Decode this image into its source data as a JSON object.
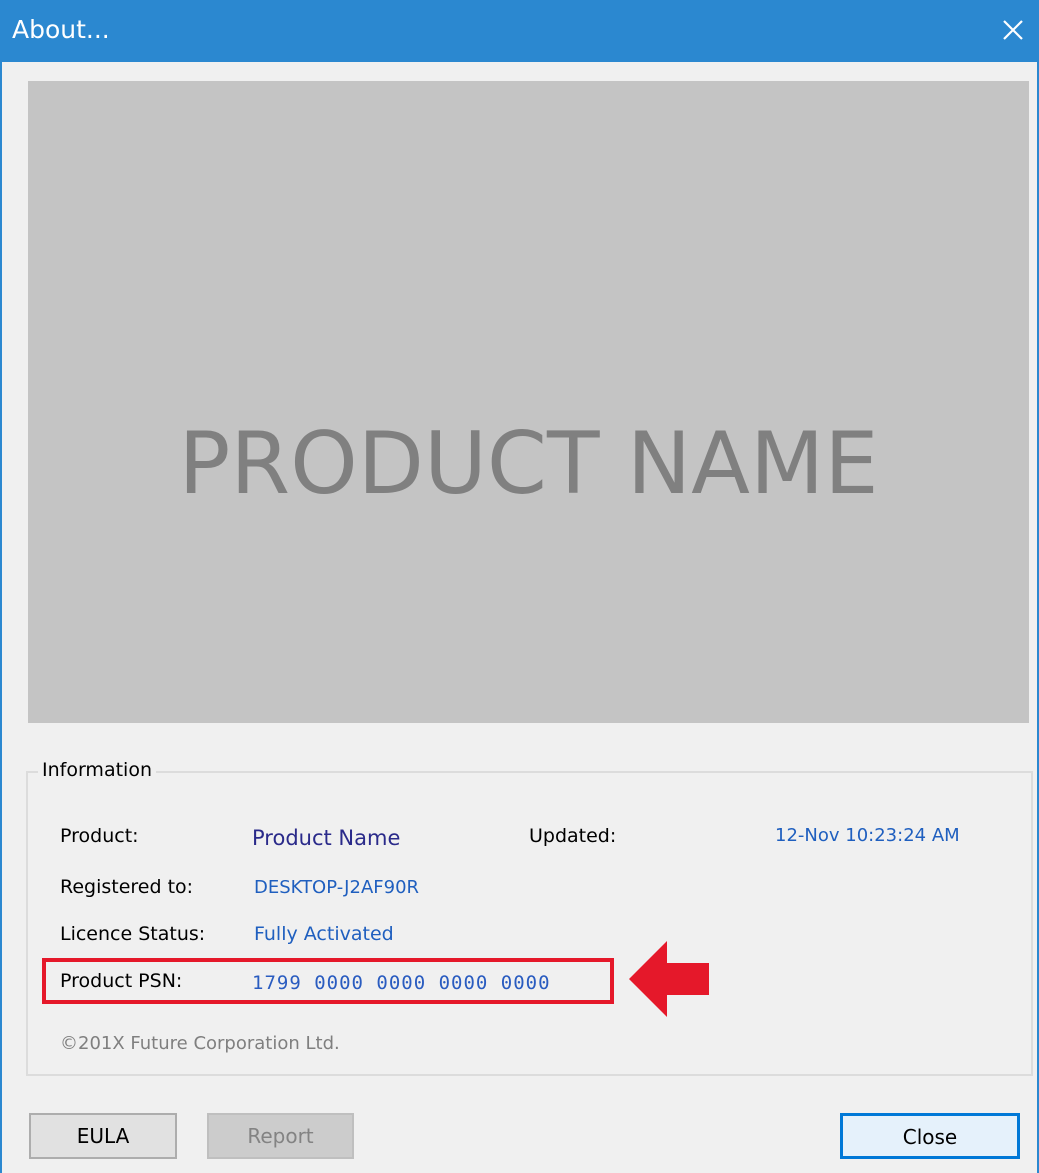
{
  "window": {
    "title": "About...",
    "close_icon": "close-x-icon"
  },
  "banner": {
    "text": "PRODUCT NAME"
  },
  "info": {
    "legend": "Information",
    "product_label": "Product:",
    "product_value": "Product Name",
    "updated_label": "Updated:",
    "updated_value": "12-Nov 10:23:24 AM",
    "registered_label": "Registered to:",
    "registered_value": "DESKTOP-J2AF90R",
    "licence_label": "Licence Status:",
    "licence_value": "Fully Activated",
    "psn_label": "Product PSN:",
    "psn_value": "1799 0000 0000 0000 0000",
    "copyright": "©201X Future Corporation Ltd."
  },
  "annotation": {
    "highlight_color": "#e5182a",
    "arrow_icon": "red-left-arrow-icon"
  },
  "buttons": {
    "eula": "EULA",
    "report": "Report",
    "close": "Close"
  },
  "colors": {
    "titlebar": "#2b88d0",
    "value_text": "#1f5fbf",
    "banner_bg": "#c4c4c4"
  }
}
